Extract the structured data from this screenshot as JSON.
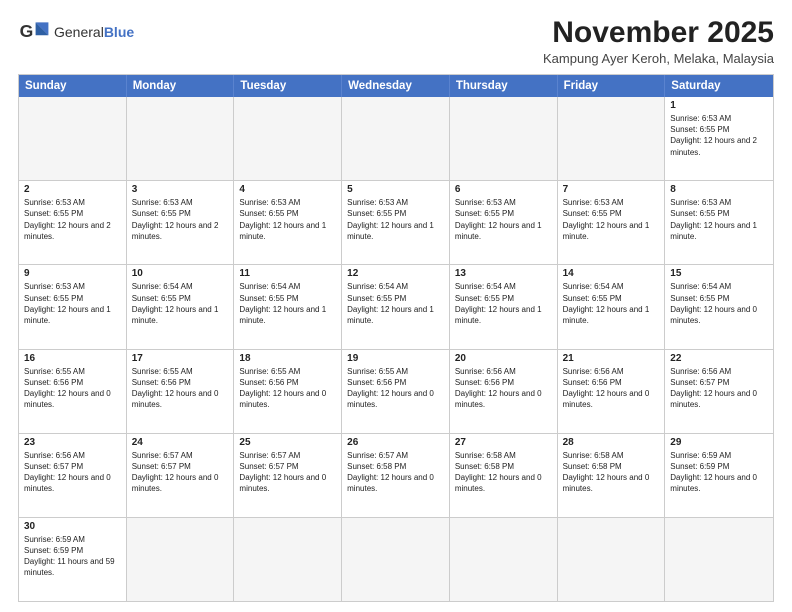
{
  "header": {
    "logo_general": "General",
    "logo_blue": "Blue",
    "month_title": "November 2025",
    "location": "Kampung Ayer Keroh, Melaka, Malaysia"
  },
  "days_of_week": [
    "Sunday",
    "Monday",
    "Tuesday",
    "Wednesday",
    "Thursday",
    "Friday",
    "Saturday"
  ],
  "weeks": [
    [
      {
        "day": "",
        "info": ""
      },
      {
        "day": "",
        "info": ""
      },
      {
        "day": "",
        "info": ""
      },
      {
        "day": "",
        "info": ""
      },
      {
        "day": "",
        "info": ""
      },
      {
        "day": "",
        "info": ""
      },
      {
        "day": "1",
        "info": "Sunrise: 6:53 AM\nSunset: 6:55 PM\nDaylight: 12 hours and 2 minutes."
      }
    ],
    [
      {
        "day": "2",
        "info": "Sunrise: 6:53 AM\nSunset: 6:55 PM\nDaylight: 12 hours and 2 minutes."
      },
      {
        "day": "3",
        "info": "Sunrise: 6:53 AM\nSunset: 6:55 PM\nDaylight: 12 hours and 2 minutes."
      },
      {
        "day": "4",
        "info": "Sunrise: 6:53 AM\nSunset: 6:55 PM\nDaylight: 12 hours and 1 minute."
      },
      {
        "day": "5",
        "info": "Sunrise: 6:53 AM\nSunset: 6:55 PM\nDaylight: 12 hours and 1 minute."
      },
      {
        "day": "6",
        "info": "Sunrise: 6:53 AM\nSunset: 6:55 PM\nDaylight: 12 hours and 1 minute."
      },
      {
        "day": "7",
        "info": "Sunrise: 6:53 AM\nSunset: 6:55 PM\nDaylight: 12 hours and 1 minute."
      },
      {
        "day": "8",
        "info": "Sunrise: 6:53 AM\nSunset: 6:55 PM\nDaylight: 12 hours and 1 minute."
      }
    ],
    [
      {
        "day": "9",
        "info": "Sunrise: 6:53 AM\nSunset: 6:55 PM\nDaylight: 12 hours and 1 minute."
      },
      {
        "day": "10",
        "info": "Sunrise: 6:54 AM\nSunset: 6:55 PM\nDaylight: 12 hours and 1 minute."
      },
      {
        "day": "11",
        "info": "Sunrise: 6:54 AM\nSunset: 6:55 PM\nDaylight: 12 hours and 1 minute."
      },
      {
        "day": "12",
        "info": "Sunrise: 6:54 AM\nSunset: 6:55 PM\nDaylight: 12 hours and 1 minute."
      },
      {
        "day": "13",
        "info": "Sunrise: 6:54 AM\nSunset: 6:55 PM\nDaylight: 12 hours and 1 minute."
      },
      {
        "day": "14",
        "info": "Sunrise: 6:54 AM\nSunset: 6:55 PM\nDaylight: 12 hours and 1 minute."
      },
      {
        "day": "15",
        "info": "Sunrise: 6:54 AM\nSunset: 6:55 PM\nDaylight: 12 hours and 0 minutes."
      }
    ],
    [
      {
        "day": "16",
        "info": "Sunrise: 6:55 AM\nSunset: 6:56 PM\nDaylight: 12 hours and 0 minutes."
      },
      {
        "day": "17",
        "info": "Sunrise: 6:55 AM\nSunset: 6:56 PM\nDaylight: 12 hours and 0 minutes."
      },
      {
        "day": "18",
        "info": "Sunrise: 6:55 AM\nSunset: 6:56 PM\nDaylight: 12 hours and 0 minutes."
      },
      {
        "day": "19",
        "info": "Sunrise: 6:55 AM\nSunset: 6:56 PM\nDaylight: 12 hours and 0 minutes."
      },
      {
        "day": "20",
        "info": "Sunrise: 6:56 AM\nSunset: 6:56 PM\nDaylight: 12 hours and 0 minutes."
      },
      {
        "day": "21",
        "info": "Sunrise: 6:56 AM\nSunset: 6:56 PM\nDaylight: 12 hours and 0 minutes."
      },
      {
        "day": "22",
        "info": "Sunrise: 6:56 AM\nSunset: 6:57 PM\nDaylight: 12 hours and 0 minutes."
      }
    ],
    [
      {
        "day": "23",
        "info": "Sunrise: 6:56 AM\nSunset: 6:57 PM\nDaylight: 12 hours and 0 minutes."
      },
      {
        "day": "24",
        "info": "Sunrise: 6:57 AM\nSunset: 6:57 PM\nDaylight: 12 hours and 0 minutes."
      },
      {
        "day": "25",
        "info": "Sunrise: 6:57 AM\nSunset: 6:57 PM\nDaylight: 12 hours and 0 minutes."
      },
      {
        "day": "26",
        "info": "Sunrise: 6:57 AM\nSunset: 6:58 PM\nDaylight: 12 hours and 0 minutes."
      },
      {
        "day": "27",
        "info": "Sunrise: 6:58 AM\nSunset: 6:58 PM\nDaylight: 12 hours and 0 minutes."
      },
      {
        "day": "28",
        "info": "Sunrise: 6:58 AM\nSunset: 6:58 PM\nDaylight: 12 hours and 0 minutes."
      },
      {
        "day": "29",
        "info": "Sunrise: 6:59 AM\nSunset: 6:59 PM\nDaylight: 12 hours and 0 minutes."
      }
    ],
    [
      {
        "day": "30",
        "info": "Sunrise: 6:59 AM\nSunset: 6:59 PM\nDaylight: 11 hours and 59 minutes."
      },
      {
        "day": "",
        "info": ""
      },
      {
        "day": "",
        "info": ""
      },
      {
        "day": "",
        "info": ""
      },
      {
        "day": "",
        "info": ""
      },
      {
        "day": "",
        "info": ""
      },
      {
        "day": "",
        "info": ""
      }
    ]
  ]
}
